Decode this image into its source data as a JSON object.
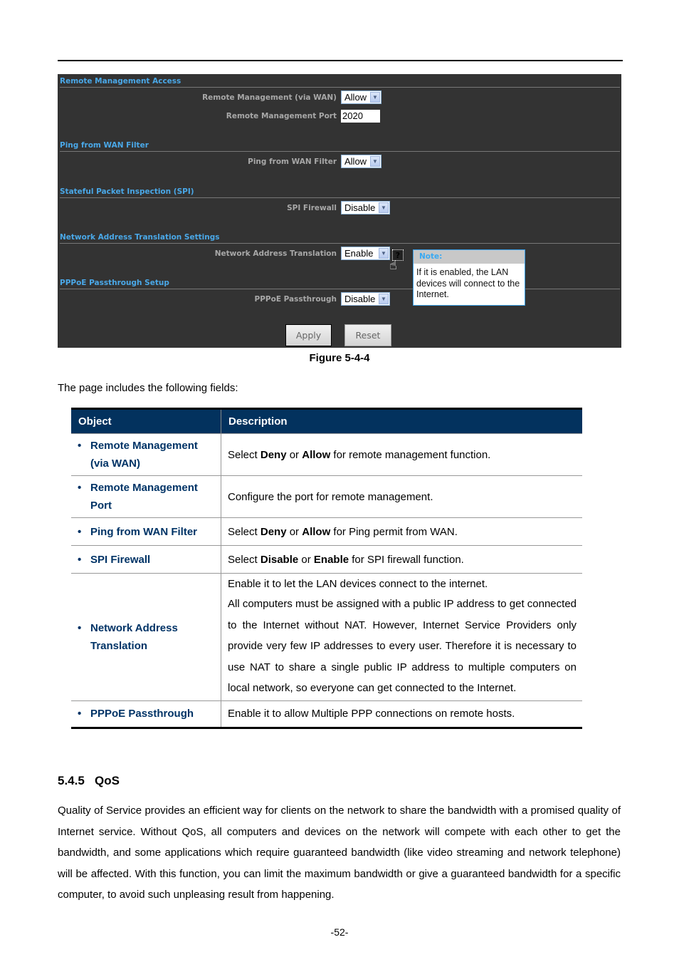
{
  "screenshot": {
    "sections": [
      {
        "title": "Remote Management Access"
      },
      {
        "title": "Ping from WAN Filter"
      },
      {
        "title": "Stateful Packet Inspection (SPI)"
      },
      {
        "title": "Network Address Translation Settings"
      },
      {
        "title": "PPPoE Passthrough Setup"
      }
    ],
    "fields": {
      "remote_mgmt_label": "Remote Management (via WAN)",
      "remote_mgmt_value": "Allow",
      "remote_port_label": "Remote Management Port",
      "remote_port_value": "2020",
      "ping_label": "Ping from WAN Filter",
      "ping_value": "Allow",
      "spi_label": "SPI Firewall",
      "spi_value": "Disable",
      "nat_label": "Network Address Translation",
      "nat_value": "Enable",
      "pppoe_label": "PPPoE Passthrough",
      "pppoe_value": "Disable"
    },
    "help_icon": "?",
    "note": {
      "title": "Note:",
      "body": "If it is enabled, the LAN devices will connect to the Internet."
    },
    "buttons": {
      "apply": "Apply",
      "reset": "Reset"
    }
  },
  "caption": "Figure 5-4-4",
  "intro": "The page includes the following fields:",
  "table": {
    "headers": [
      "Object",
      "Description"
    ],
    "rows": [
      {
        "object": "Remote Management (via WAN)",
        "desc_parts": [
          "Select ",
          "Deny",
          " or ",
          "Allow",
          " for remote management function."
        ]
      },
      {
        "object": "Remote Management Port",
        "desc": "Configure the port for remote management."
      },
      {
        "object": "Ping from WAN Filter",
        "desc_parts": [
          "Select ",
          "Deny",
          " or ",
          "Allow",
          " for Ping permit from WAN."
        ]
      },
      {
        "object": "SPI Firewall",
        "desc_parts": [
          "Select ",
          "Disable",
          " or ",
          "Enable",
          " for SPI firewall function."
        ]
      },
      {
        "object": "Network Address Translation",
        "desc_lines": [
          "Enable it to let the LAN devices connect to the internet.",
          "All computers must be assigned with a public IP address to get connected to the Internet without NAT. However, Internet Service Providers only provide very few IP addresses to every user. Therefore it is necessary to use NAT to share a single public IP address to multiple computers on local network, so everyone can get connected to the Internet."
        ]
      },
      {
        "object": "PPPoE Passthrough",
        "desc": "Enable it to allow Multiple PPP connections on remote hosts."
      }
    ]
  },
  "section_heading": "5.4.5   QoS",
  "section_paragraph": "Quality of Service provides an efficient way for clients on the network to share the bandwidth with a promised quality of Internet service. Without QoS, all computers and devices on the network will compete with each other to get the bandwidth, and some applications which require guaranteed bandwidth (like video streaming and network telephone) will be affected. With this function, you can limit the maximum bandwidth or give a guaranteed bandwidth for a specific computer, to avoid such unpleasing result from happening.",
  "page_number": "-52-"
}
